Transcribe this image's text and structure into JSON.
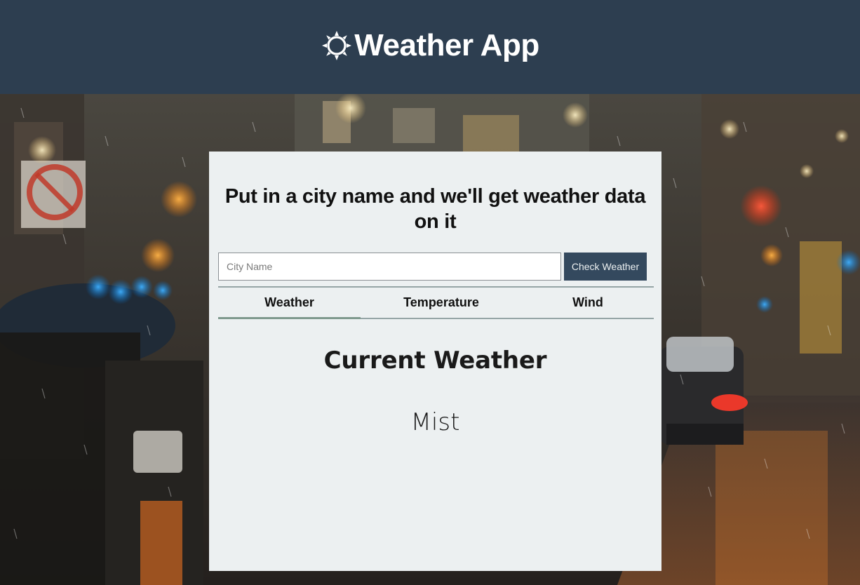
{
  "header": {
    "title": "Weather App",
    "icon": "sun-icon"
  },
  "form": {
    "heading": "Put in a city name and we'll get weather data on it",
    "city_placeholder": "City Name",
    "city_value": "",
    "submit_label": "Check Weather"
  },
  "tabs": [
    {
      "label": "Weather",
      "active": true
    },
    {
      "label": "Temperature",
      "active": false
    },
    {
      "label": "Wind",
      "active": false
    }
  ],
  "panel": {
    "title": "Current Weather",
    "value": "Mist"
  },
  "colors": {
    "header_bg": "#2d3e50",
    "card_bg": "#ecf0f1",
    "button_bg": "#34495e",
    "tab_border": "#95a5a6",
    "tab_active": "#7f9a8e"
  }
}
